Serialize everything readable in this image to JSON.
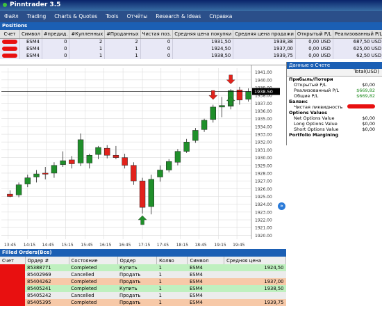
{
  "app": {
    "title": "Pinntrader 3.5"
  },
  "menu": [
    "Файл",
    "Trading",
    "Charts & Quotes",
    "Tools",
    "Отчёты",
    "Research & Ideas",
    "Справка"
  ],
  "positions": {
    "title": "Positions",
    "headers": [
      "Счет",
      "Символ",
      "#предид.",
      "#Купленных",
      "#Проданных",
      "Чистая поз.",
      "Средняя цена покупки",
      "Средняя цена продажи",
      "Открытый P/L",
      "Реализованный P/L"
    ],
    "rows": [
      [
        "",
        "ESM4",
        "0",
        "2",
        "2",
        "0",
        "1931,50",
        "1938,38",
        "0,00 USD",
        "687,50 USD"
      ],
      [
        "",
        "ESM4",
        "0",
        "1",
        "1",
        "0",
        "1924,50",
        "1937,00",
        "0,00 USD",
        "625,00 USD"
      ],
      [
        "",
        "ESM4",
        "0",
        "1",
        "1",
        "0",
        "1938,50",
        "1939,75",
        "0,00 USD",
        "62,50 USD"
      ]
    ]
  },
  "chart_data": {
    "type": "candlestick",
    "instrument": "ESM4",
    "current_price_label": "1938.50",
    "ylim": [
      1919.5,
      1941.5
    ],
    "y_ticks": [
      "1941.00",
      "1940.00",
      "1939.00",
      "1938.00",
      "1937.00",
      "1936.00",
      "1935.00",
      "1934.00",
      "1933.00",
      "1932.00",
      "1931.00",
      "1930.00",
      "1929.00",
      "1928.00",
      "1927.00",
      "1926.00",
      "1925.00",
      "1924.00",
      "1923.00",
      "1922.00",
      "1921.00",
      "1920.00"
    ],
    "x_ticks": [
      "13:45",
      "14:15",
      "14:45",
      "15:15",
      "15:45",
      "16:15",
      "16:45",
      "17:15",
      "17:45",
      "18:15",
      "18:45",
      "19:15",
      "19:45"
    ],
    "candles": [
      {
        "o": 1925.3,
        "h": 1925.8,
        "l": 1924.9,
        "c": 1925.0
      },
      {
        "o": 1925.2,
        "h": 1926.8,
        "l": 1924.9,
        "c": 1926.5
      },
      {
        "o": 1926.6,
        "h": 1927.8,
        "l": 1926.2,
        "c": 1927.4
      },
      {
        "o": 1927.5,
        "h": 1928.4,
        "l": 1926.8,
        "c": 1927.9
      },
      {
        "o": 1928.0,
        "h": 1928.8,
        "l": 1927.2,
        "c": 1927.9
      },
      {
        "o": 1928.0,
        "h": 1929.4,
        "l": 1927.4,
        "c": 1929.0
      },
      {
        "o": 1929.1,
        "h": 1930.8,
        "l": 1928.8,
        "c": 1929.6
      },
      {
        "o": 1929.7,
        "h": 1930.2,
        "l": 1928.6,
        "c": 1929.2
      },
      {
        "o": 1929.3,
        "h": 1933.1,
        "l": 1928.9,
        "c": 1932.3
      },
      {
        "o": 1929.3,
        "h": 1930.5,
        "l": 1928.6,
        "c": 1930.3
      },
      {
        "o": 1930.4,
        "h": 1931.5,
        "l": 1929.8,
        "c": 1931.3
      },
      {
        "o": 1931.2,
        "h": 1931.6,
        "l": 1929.9,
        "c": 1930.3
      },
      {
        "o": 1930.3,
        "h": 1931.5,
        "l": 1929.8,
        "c": 1930.0
      },
      {
        "o": 1930.0,
        "h": 1930.5,
        "l": 1928.6,
        "c": 1929.0
      },
      {
        "o": 1929.0,
        "h": 1929.4,
        "l": 1926.5,
        "c": 1927.0
      },
      {
        "o": 1927.0,
        "h": 1927.4,
        "l": 1922.8,
        "c": 1923.6
      },
      {
        "o": 1923.7,
        "h": 1927.8,
        "l": 1922.7,
        "c": 1927.2
      },
      {
        "o": 1927.5,
        "h": 1929.0,
        "l": 1926.9,
        "c": 1928.4
      },
      {
        "o": 1928.4,
        "h": 1929.8,
        "l": 1928.1,
        "c": 1929.5
      },
      {
        "o": 1929.4,
        "h": 1931.1,
        "l": 1929.0,
        "c": 1930.8
      },
      {
        "o": 1930.8,
        "h": 1932.4,
        "l": 1930.6,
        "c": 1932.0
      },
      {
        "o": 1932.2,
        "h": 1933.8,
        "l": 1931.9,
        "c": 1933.5
      },
      {
        "o": 1933.6,
        "h": 1935.0,
        "l": 1933.3,
        "c": 1934.8
      },
      {
        "o": 1934.9,
        "h": 1936.8,
        "l": 1934.5,
        "c": 1936.5
      },
      {
        "o": 1936.5,
        "h": 1937.8,
        "l": 1935.2,
        "c": 1936.7
      },
      {
        "o": 1936.6,
        "h": 1938.8,
        "l": 1936.2,
        "c": 1938.6
      },
      {
        "o": 1938.7,
        "h": 1939.1,
        "l": 1936.8,
        "c": 1937.4
      },
      {
        "o": 1937.5,
        "h": 1938.9,
        "l": 1937.2,
        "c": 1938.5
      }
    ],
    "markers": [
      {
        "candle": 15,
        "dir": "up",
        "price": 1922.0
      },
      {
        "candle": 23,
        "dir": "down",
        "price": 1938.0
      },
      {
        "candle": 25,
        "dir": "up",
        "price": 1937.3
      },
      {
        "candle": 25,
        "dir": "down",
        "price": 1940.0
      }
    ]
  },
  "account": {
    "title": "Данные о Счете",
    "column": "Total(USD)",
    "rows": [
      {
        "label": "Прибыль/Потери",
        "value": "",
        "type": "sec"
      },
      {
        "label": "Открытый P/L",
        "value": "$0,00",
        "type": "ind"
      },
      {
        "label": "Реализованный P/L",
        "value": "$669,82",
        "type": "ind",
        "color": "#1c8a1c"
      },
      {
        "label": "Общие P/L",
        "value": "$669,82",
        "type": "ind",
        "color": "#1c8a1c"
      },
      {
        "label": "Баланс",
        "value": "",
        "type": "sec"
      },
      {
        "label": "Чистая ликвидность",
        "value": "",
        "type": "ind",
        "redact": true
      },
      {
        "label": "Options Values",
        "value": "",
        "type": "sec"
      },
      {
        "label": "Net Options Value",
        "value": "$0,00",
        "type": "ind"
      },
      {
        "label": "Long Options Value",
        "value": "$0,00",
        "type": "ind"
      },
      {
        "label": "Short Options Value",
        "value": "$0,00",
        "type": "ind"
      },
      {
        "label": "Portfolio Margining",
        "value": "",
        "type": "sec"
      }
    ]
  },
  "filled": {
    "title": "Filled Orders(Все)",
    "headers": [
      "Счет",
      "Ордер #",
      "Состояние",
      "Ордер",
      "Колво",
      "Символ",
      "Средняя цена"
    ],
    "rows": [
      {
        "id": "85388771",
        "state": "Completed",
        "side": "Купить",
        "qty": "1",
        "sym": "ESM4",
        "price": "1924,50",
        "kind": "b"
      },
      {
        "id": "85402969",
        "state": "Cancelled",
        "side": "Продать",
        "qty": "1",
        "sym": "ESM4",
        "price": "",
        "kind": "c"
      },
      {
        "id": "85404262",
        "state": "Completed",
        "side": "Продать",
        "qty": "1",
        "sym": "ESM4",
        "price": "1937,00",
        "kind": "s"
      },
      {
        "id": "85405241",
        "state": "Completed",
        "side": "Купить",
        "qty": "1",
        "sym": "ESM4",
        "price": "1938,50",
        "kind": "b"
      },
      {
        "id": "85405242",
        "state": "Cancelled",
        "side": "Продать",
        "qty": "1",
        "sym": "ESM4",
        "price": "",
        "kind": "c"
      },
      {
        "id": "85405395",
        "state": "Completed",
        "side": "Продать",
        "qty": "1",
        "sym": "ESM4",
        "price": "1939,75",
        "kind": "s"
      }
    ]
  },
  "colors": {
    "up": "#1f8f2a",
    "down": "#e2221b",
    "accent": "#1b5fb4"
  }
}
